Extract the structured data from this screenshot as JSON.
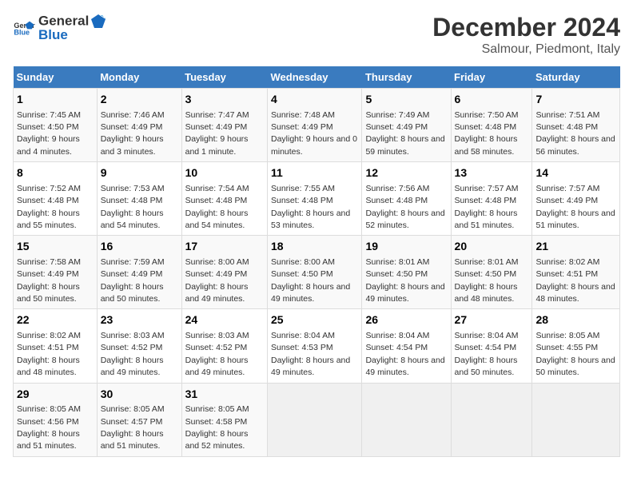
{
  "header": {
    "logo_general": "General",
    "logo_blue": "Blue",
    "title": "December 2024",
    "subtitle": "Salmour, Piedmont, Italy"
  },
  "weekdays": [
    "Sunday",
    "Monday",
    "Tuesday",
    "Wednesday",
    "Thursday",
    "Friday",
    "Saturday"
  ],
  "weeks": [
    [
      {
        "day": "1",
        "sunrise": "7:45 AM",
        "sunset": "4:50 PM",
        "daylight": "9 hours and 4 minutes."
      },
      {
        "day": "2",
        "sunrise": "7:46 AM",
        "sunset": "4:49 PM",
        "daylight": "9 hours and 3 minutes."
      },
      {
        "day": "3",
        "sunrise": "7:47 AM",
        "sunset": "4:49 PM",
        "daylight": "9 hours and 1 minute."
      },
      {
        "day": "4",
        "sunrise": "7:48 AM",
        "sunset": "4:49 PM",
        "daylight": "9 hours and 0 minutes."
      },
      {
        "day": "5",
        "sunrise": "7:49 AM",
        "sunset": "4:49 PM",
        "daylight": "8 hours and 59 minutes."
      },
      {
        "day": "6",
        "sunrise": "7:50 AM",
        "sunset": "4:48 PM",
        "daylight": "8 hours and 58 minutes."
      },
      {
        "day": "7",
        "sunrise": "7:51 AM",
        "sunset": "4:48 PM",
        "daylight": "8 hours and 56 minutes."
      }
    ],
    [
      {
        "day": "8",
        "sunrise": "7:52 AM",
        "sunset": "4:48 PM",
        "daylight": "8 hours and 55 minutes."
      },
      {
        "day": "9",
        "sunrise": "7:53 AM",
        "sunset": "4:48 PM",
        "daylight": "8 hours and 54 minutes."
      },
      {
        "day": "10",
        "sunrise": "7:54 AM",
        "sunset": "4:48 PM",
        "daylight": "8 hours and 54 minutes."
      },
      {
        "day": "11",
        "sunrise": "7:55 AM",
        "sunset": "4:48 PM",
        "daylight": "8 hours and 53 minutes."
      },
      {
        "day": "12",
        "sunrise": "7:56 AM",
        "sunset": "4:48 PM",
        "daylight": "8 hours and 52 minutes."
      },
      {
        "day": "13",
        "sunrise": "7:57 AM",
        "sunset": "4:48 PM",
        "daylight": "8 hours and 51 minutes."
      },
      {
        "day": "14",
        "sunrise": "7:57 AM",
        "sunset": "4:49 PM",
        "daylight": "8 hours and 51 minutes."
      }
    ],
    [
      {
        "day": "15",
        "sunrise": "7:58 AM",
        "sunset": "4:49 PM",
        "daylight": "8 hours and 50 minutes."
      },
      {
        "day": "16",
        "sunrise": "7:59 AM",
        "sunset": "4:49 PM",
        "daylight": "8 hours and 50 minutes."
      },
      {
        "day": "17",
        "sunrise": "8:00 AM",
        "sunset": "4:49 PM",
        "daylight": "8 hours and 49 minutes."
      },
      {
        "day": "18",
        "sunrise": "8:00 AM",
        "sunset": "4:50 PM",
        "daylight": "8 hours and 49 minutes."
      },
      {
        "day": "19",
        "sunrise": "8:01 AM",
        "sunset": "4:50 PM",
        "daylight": "8 hours and 49 minutes."
      },
      {
        "day": "20",
        "sunrise": "8:01 AM",
        "sunset": "4:50 PM",
        "daylight": "8 hours and 48 minutes."
      },
      {
        "day": "21",
        "sunrise": "8:02 AM",
        "sunset": "4:51 PM",
        "daylight": "8 hours and 48 minutes."
      }
    ],
    [
      {
        "day": "22",
        "sunrise": "8:02 AM",
        "sunset": "4:51 PM",
        "daylight": "8 hours and 48 minutes."
      },
      {
        "day": "23",
        "sunrise": "8:03 AM",
        "sunset": "4:52 PM",
        "daylight": "8 hours and 49 minutes."
      },
      {
        "day": "24",
        "sunrise": "8:03 AM",
        "sunset": "4:52 PM",
        "daylight": "8 hours and 49 minutes."
      },
      {
        "day": "25",
        "sunrise": "8:04 AM",
        "sunset": "4:53 PM",
        "daylight": "8 hours and 49 minutes."
      },
      {
        "day": "26",
        "sunrise": "8:04 AM",
        "sunset": "4:54 PM",
        "daylight": "8 hours and 49 minutes."
      },
      {
        "day": "27",
        "sunrise": "8:04 AM",
        "sunset": "4:54 PM",
        "daylight": "8 hours and 50 minutes."
      },
      {
        "day": "28",
        "sunrise": "8:05 AM",
        "sunset": "4:55 PM",
        "daylight": "8 hours and 50 minutes."
      }
    ],
    [
      {
        "day": "29",
        "sunrise": "8:05 AM",
        "sunset": "4:56 PM",
        "daylight": "8 hours and 51 minutes."
      },
      {
        "day": "30",
        "sunrise": "8:05 AM",
        "sunset": "4:57 PM",
        "daylight": "8 hours and 51 minutes."
      },
      {
        "day": "31",
        "sunrise": "8:05 AM",
        "sunset": "4:58 PM",
        "daylight": "8 hours and 52 minutes."
      },
      null,
      null,
      null,
      null
    ]
  ]
}
